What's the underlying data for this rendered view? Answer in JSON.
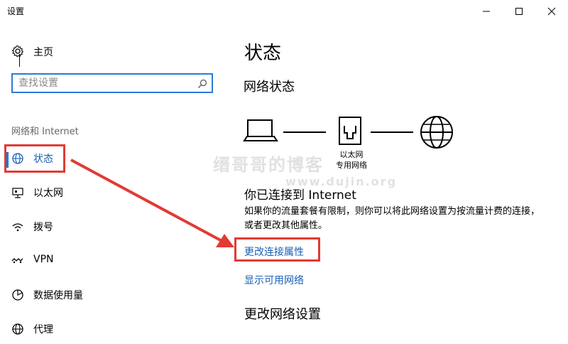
{
  "window": {
    "title": "设置",
    "controls": {
      "minimize": "minimize-icon",
      "maximize": "maximize-icon",
      "close": "close-icon"
    }
  },
  "sidebar": {
    "home_label": "主页",
    "search_placeholder": "查找设置",
    "section_label": "网络和 Internet",
    "items": [
      {
        "label": "状态",
        "icon": "globe-icon",
        "selected": true
      },
      {
        "label": "以太网",
        "icon": "ethernet-icon",
        "selected": false
      },
      {
        "label": "拨号",
        "icon": "dialup-icon",
        "selected": false
      },
      {
        "label": "VPN",
        "icon": "vpn-icon",
        "selected": false
      },
      {
        "label": "数据使用量",
        "icon": "data-usage-icon",
        "selected": false
      },
      {
        "label": "代理",
        "icon": "globe-icon",
        "selected": false
      }
    ]
  },
  "main": {
    "title": "状态",
    "network_status_heading": "网络状态",
    "router_label_line1": "以太网",
    "router_label_line2": "专用网络",
    "connected_title": "你已连接到 Internet",
    "connected_desc": "如果你的流量套餐有限制，则你可以将此网络设置为按流量计费的连接，或者更改其他属性。",
    "link_change_properties": "更改连接属性",
    "link_show_networks": "显示可用网络",
    "change_settings_heading": "更改网络设置"
  },
  "watermark": {
    "line1": "缙哥哥的博客",
    "line2": "www.dujin.org"
  },
  "colors": {
    "accent": "#0078d7",
    "link": "#1a5fb4",
    "annotation": "#e23a35"
  }
}
